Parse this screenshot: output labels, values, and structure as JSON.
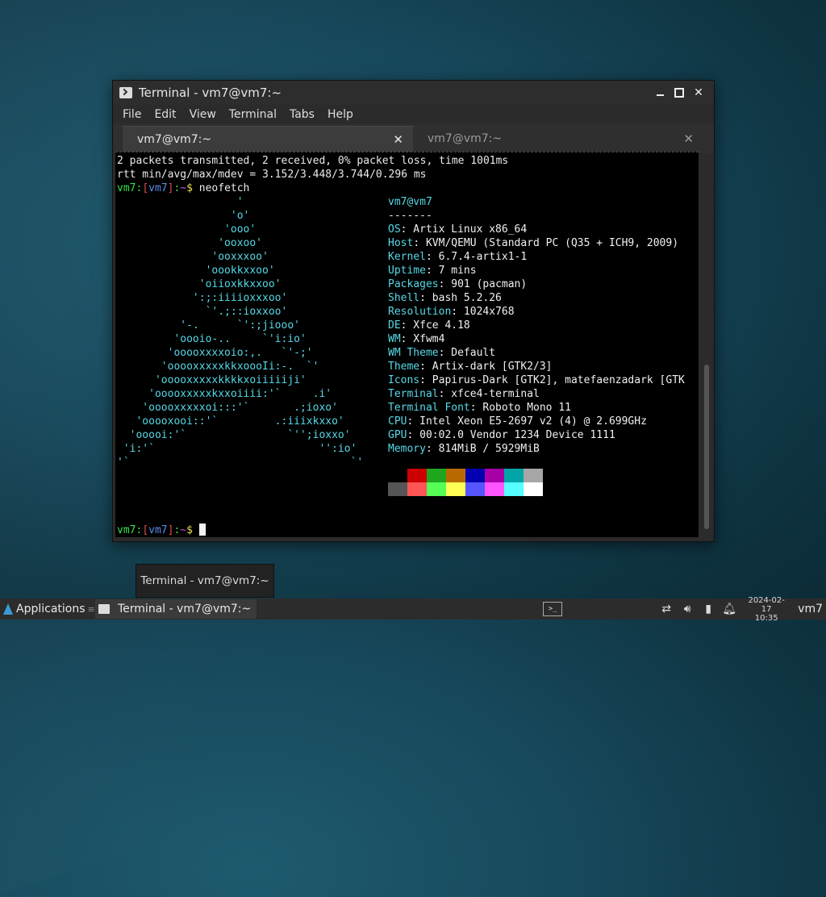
{
  "window": {
    "title": "Terminal - vm7@vm7:~",
    "menus": [
      "File",
      "Edit",
      "View",
      "Terminal",
      "Tabs",
      "Help"
    ],
    "tabs": [
      {
        "label": "vm7@vm7:~",
        "active": true
      },
      {
        "label": "vm7@vm7:~",
        "active": false
      }
    ]
  },
  "terminal": {
    "line1": "2 packets transmitted, 2 received, 0% packet loss, time 1001ms",
    "line2": "rtt min/avg/max/mdev = 3.152/3.448/3.744/0.296 ms",
    "prompt_user": "vm7",
    "prompt_host": "vm7",
    "prompt_path": "~",
    "command": "neofetch",
    "logo": [
      "                   '",
      "                  'o'",
      "                 'ooo'",
      "                'ooxoo'",
      "               'ooxxxoo'",
      "              'oookkxxoo'",
      "             'oiioxkkxxoo'",
      "            ':;:iiiioxxxoo'",
      "              `'.;::ioxxoo'",
      "          '-.      `':;jiooo'",
      "         'oooio-..     `'i:io'",
      "        'ooooxxxxoio:,.   `'-;'",
      "       'ooooxxxxxkkxoooIi:-.  `'",
      "      'ooooxxxxxkkkkxoiiiiiji'",
      "     'ooooxxxxxkxxoiiii:'`     .i'",
      "    'ooooxxxxxoi:::'`       .;ioxo'",
      "   'ooooxooi::'`         .:iiixkxxo'",
      "  'ooooi:'`                `'';ioxxo'",
      " 'i:'`                          '':io'",
      "'`                                   `'"
    ],
    "info_header": "vm7@vm7",
    "info_sep": "-------",
    "info": [
      {
        "key": "OS",
        "value": "Artix Linux x86_64"
      },
      {
        "key": "Host",
        "value": "KVM/QEMU (Standard PC (Q35 + ICH9, 2009)"
      },
      {
        "key": "Kernel",
        "value": "6.7.4-artix1-1"
      },
      {
        "key": "Uptime",
        "value": "7 mins"
      },
      {
        "key": "Packages",
        "value": "901 (pacman)"
      },
      {
        "key": "Shell",
        "value": "bash 5.2.26"
      },
      {
        "key": "Resolution",
        "value": "1024x768"
      },
      {
        "key": "DE",
        "value": "Xfce 4.18"
      },
      {
        "key": "WM",
        "value": "Xfwm4"
      },
      {
        "key": "WM Theme",
        "value": "Default"
      },
      {
        "key": "Theme",
        "value": "Artix-dark [GTK2/3]"
      },
      {
        "key": "Icons",
        "value": "Papirus-Dark [GTK2], matefaenzadark [GTK"
      },
      {
        "key": "Terminal",
        "value": "xfce4-terminal"
      },
      {
        "key": "Terminal Font",
        "value": "Roboto Mono 11"
      },
      {
        "key": "CPU",
        "value": "Intel Xeon E5-2697 v2 (4) @ 2.699GHz"
      },
      {
        "key": "GPU",
        "value": "00:02.0 Vendor 1234 Device 1111"
      },
      {
        "key": "Memory",
        "value": "814MiB / 5929MiB"
      }
    ],
    "palette_row1": [
      "#000000",
      "#cc0000",
      "#1ea61e",
      "#b86a00",
      "#0000b0",
      "#a600a6",
      "#00a6a6",
      "#a6a6a6"
    ],
    "palette_row2": [
      "#555555",
      "#ff5555",
      "#55ff55",
      "#ffff55",
      "#5555ff",
      "#ff55ff",
      "#55ffff",
      "#ffffff"
    ]
  },
  "tooltip": "Terminal - vm7@vm7:~",
  "taskbar": {
    "applications_label": "Applications",
    "task_label": "Terminal - vm7@vm7:~",
    "clock_date": "2024-02-17",
    "clock_time": "10:35",
    "user": "vm7"
  }
}
